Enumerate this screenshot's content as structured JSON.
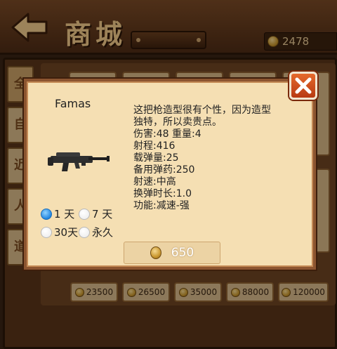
{
  "header": {
    "title": "商城",
    "coin_balance": "2478"
  },
  "sidebar": {
    "tabs": [
      {
        "label": "全"
      },
      {
        "label": "自"
      },
      {
        "label": "近"
      },
      {
        "label": "人"
      },
      {
        "label": "道"
      }
    ]
  },
  "shop_prices": [
    "23500",
    "26500",
    "35000",
    "88000",
    "120000"
  ],
  "dialog": {
    "weapon_name": "Famas",
    "description_lines": [
      "这把枪造型很有个性，因为造型",
      "独特，所以卖贵点。",
      "伤害:48 重量:4",
      "射程:416",
      "载弹量:25",
      "备用弹药:250",
      "射速:中高",
      "换弹时长:1.0",
      "功能:减速-强"
    ],
    "rental_options": [
      {
        "label": "1 天",
        "selected": true
      },
      {
        "label": "7 天",
        "selected": false
      },
      {
        "label": "30天",
        "selected": false
      },
      {
        "label": "永久",
        "selected": false
      }
    ],
    "price": "650"
  },
  "icons": {
    "back": "back-arrow-icon",
    "coin": "coin-icon",
    "close": "close-icon",
    "weapon": "rifle-icon"
  },
  "colors": {
    "dialog_bg": "#f5dfb3",
    "dialog_border": "#8c5530",
    "close_button": "#d8531f",
    "coin_gold": "#c9972f",
    "radio_selected": "#2185e0"
  }
}
